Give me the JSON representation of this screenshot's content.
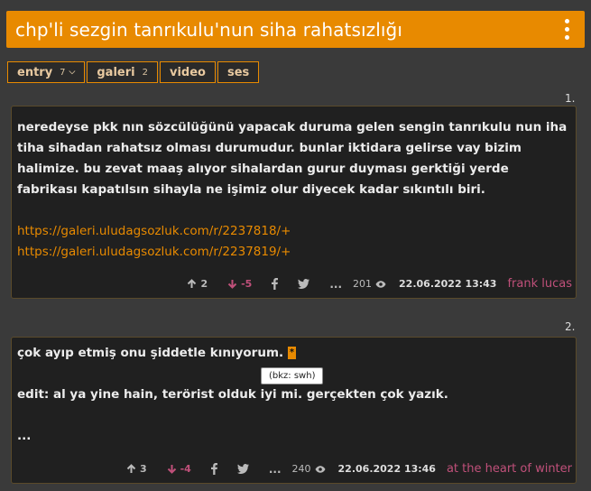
{
  "topic": {
    "title": "chp'li sezgin tanrıkulu'nun siha rahatsızlığı"
  },
  "tabs": [
    {
      "label": "entry",
      "count": "7",
      "has_caret": true
    },
    {
      "label": "galeri",
      "count": "2"
    },
    {
      "label": "video",
      "count": ""
    },
    {
      "label": "ses",
      "count": ""
    }
  ],
  "entries": [
    {
      "number": "1.",
      "text": "neredeyse pkk nın sözcülüğünü yapacak duruma gelen sengin tanrıkulu nun iha tiha sihadan rahatsız olması durumudur. bunlar iktidara gelirse vay bizim halimize. bu zevat maaş alıyor sihalardan gurur duyması gerktiği yerde fabrikası kapatılsın sihayla ne işimiz olur diyecek kadar sıkıntılı biri.",
      "links": [
        "https://galeri.uludagsozluk.com/r/2237818/+",
        "https://galeri.uludagsozluk.com/r/2237819/+"
      ],
      "upvotes": "2",
      "downvotes": "-5",
      "dots": "...",
      "views": "201",
      "date": "22.06.2022 13:43",
      "author": "frank lucas"
    },
    {
      "number": "2.",
      "line1": "çok ayıp etmiş onu şiddetle kınıyorum.",
      "star": "*",
      "tooltip": "(bkz: swh)",
      "line2": "edit: al ya yine hain, terörist olduk iyi mi. gerçekten çok yazık.",
      "line3": "...",
      "upvotes": "3",
      "downvotes": "-4",
      "dots": "...",
      "views": "240",
      "date": "22.06.2022 13:46",
      "author": "at the heart of winter"
    }
  ],
  "colors": {
    "accent": "#e88a00",
    "background": "#3a3a3a",
    "entry_bg": "#202020",
    "author": "#c0507a"
  }
}
